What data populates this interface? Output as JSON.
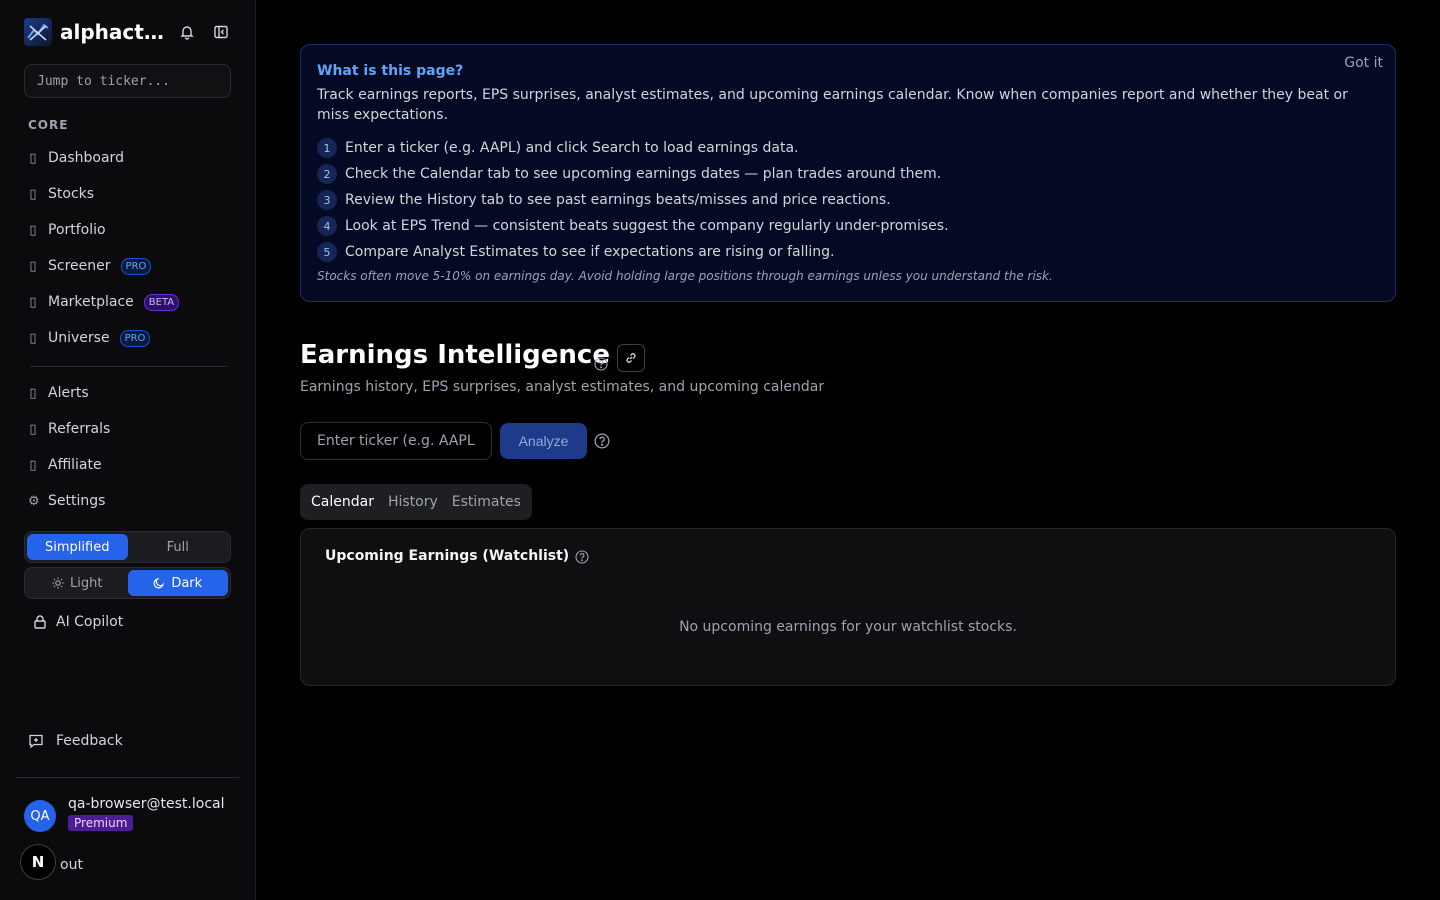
{
  "app": {
    "brand": "alphactual",
    "jump_placeholder": "Jump to ticker..."
  },
  "sidebar": {
    "section_core": "CORE",
    "core_items": [
      {
        "label": "Dashboard",
        "glyph": "▯"
      },
      {
        "label": "Stocks",
        "glyph": "▯"
      },
      {
        "label": "Portfolio",
        "glyph": "▯"
      },
      {
        "label": "Screener",
        "glyph": "▯",
        "badge": "PRO"
      },
      {
        "label": "Marketplace",
        "glyph": "▯",
        "badge": "BETA"
      },
      {
        "label": "Universe",
        "glyph": "▯",
        "badge": "PRO"
      }
    ],
    "other_items": [
      {
        "label": "Alerts",
        "glyph": "▯"
      },
      {
        "label": "Referrals",
        "glyph": "▯"
      },
      {
        "label": "Affiliate",
        "glyph": "▯"
      },
      {
        "label": "Settings",
        "glyph": "⚙"
      }
    ],
    "mode_toggle": {
      "simplified": "Simplified",
      "full": "Full",
      "selected": "Simplified"
    },
    "theme_toggle": {
      "light": "Light",
      "dark": "Dark",
      "selected": "Dark"
    },
    "copilot": "AI Copilot",
    "feedback": "Feedback",
    "user": {
      "initials": "QA",
      "email": "qa-browser@test.local",
      "plan": "Premium"
    },
    "signout": "out",
    "n_badge": "N"
  },
  "info_box": {
    "title": "What is this page?",
    "dismiss": "Got it",
    "description": "Track earnings reports, EPS surprises, analyst estimates, and upcoming earnings calendar. Know when companies report and whether they beat or miss expectations.",
    "steps": [
      {
        "num": "1",
        "text": "Enter a ticker (e.g. AAPL) and click Search to load earnings data."
      },
      {
        "num": "2",
        "text": "Check the Calendar tab to see upcoming earnings dates — plan trades around them."
      },
      {
        "num": "3",
        "text": "Review the History tab to see past earnings beats/misses and price reactions."
      },
      {
        "num": "4",
        "text": "Look at EPS Trend — consistent beats suggest the company regularly under-promises."
      },
      {
        "num": "5",
        "text": "Compare Analyst Estimates to see if expectations are rising or falling."
      }
    ],
    "note": "Stocks often move 5-10% on earnings day. Avoid holding large positions through earnings unless you understand the risk."
  },
  "page": {
    "title": "Earnings Intelligence",
    "subtitle": "Earnings history, EPS surprises, analyst estimates, and upcoming calendar",
    "ticker_placeholder": "Enter ticker (e.g. AAPL)",
    "analyze_label": "Analyze",
    "tabs": [
      "Calendar",
      "History",
      "Estimates"
    ],
    "active_tab": "Calendar"
  },
  "card": {
    "title": "Upcoming Earnings (Watchlist)",
    "empty_message": "No upcoming earnings for your watchlist stocks."
  },
  "colors": {
    "accent": "#2563eb",
    "info_title": "#60a5fa",
    "background": "#000000"
  }
}
